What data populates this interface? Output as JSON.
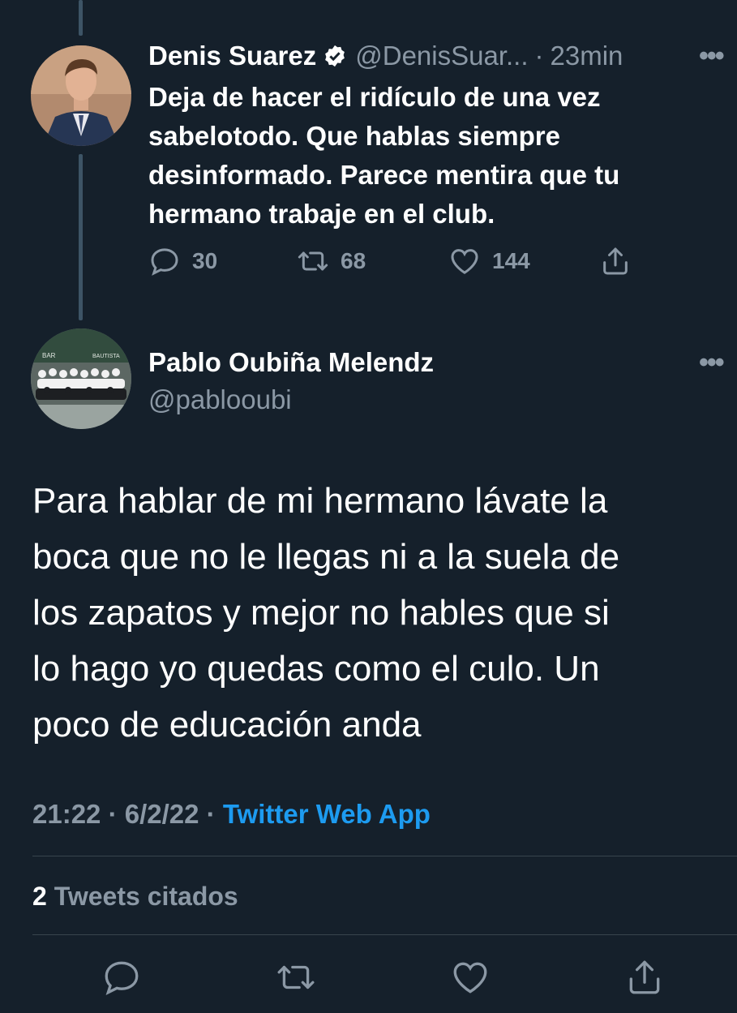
{
  "reply_to_tweet": {
    "display_name": "Denis Suarez",
    "handle": "@DenisSuar...",
    "separator": "·",
    "time": "23min",
    "more": "•••",
    "text_lines": [
      "Deja de hacer el ridículo de una vez",
      "sabelotodo. Que hablas siempre",
      "desinformado. Parece mentira que tu",
      "hermano trabaje en el club."
    ],
    "replies": "30",
    "retweets": "68",
    "likes": "144"
  },
  "main_tweet": {
    "display_name": "Pablo Oubiña Melendz",
    "handle": "@pablooubi",
    "more": "•••",
    "text_lines": [
      "Para hablar de mi hermano lávate la",
      "boca que no le llegas ni a la suela de",
      "los zapatos y mejor no hables que si",
      "lo hago yo quedas como el culo. Un",
      "poco de educación anda"
    ],
    "time": "21:22",
    "date": "6/2/22",
    "separator": "·",
    "source": "Twitter Web App",
    "quote_count": "2",
    "quote_label": "Tweets citados"
  },
  "avatar_sign_text": [
    "BAR",
    "BAUTISTA"
  ],
  "colors": {
    "background": "#15202b",
    "muted": "#8b98a5",
    "link": "#1d9bf0",
    "divider": "#38444d"
  },
  "icons": [
    "verified-badge-icon",
    "reply-icon",
    "retweet-icon",
    "like-icon",
    "share-icon"
  ]
}
